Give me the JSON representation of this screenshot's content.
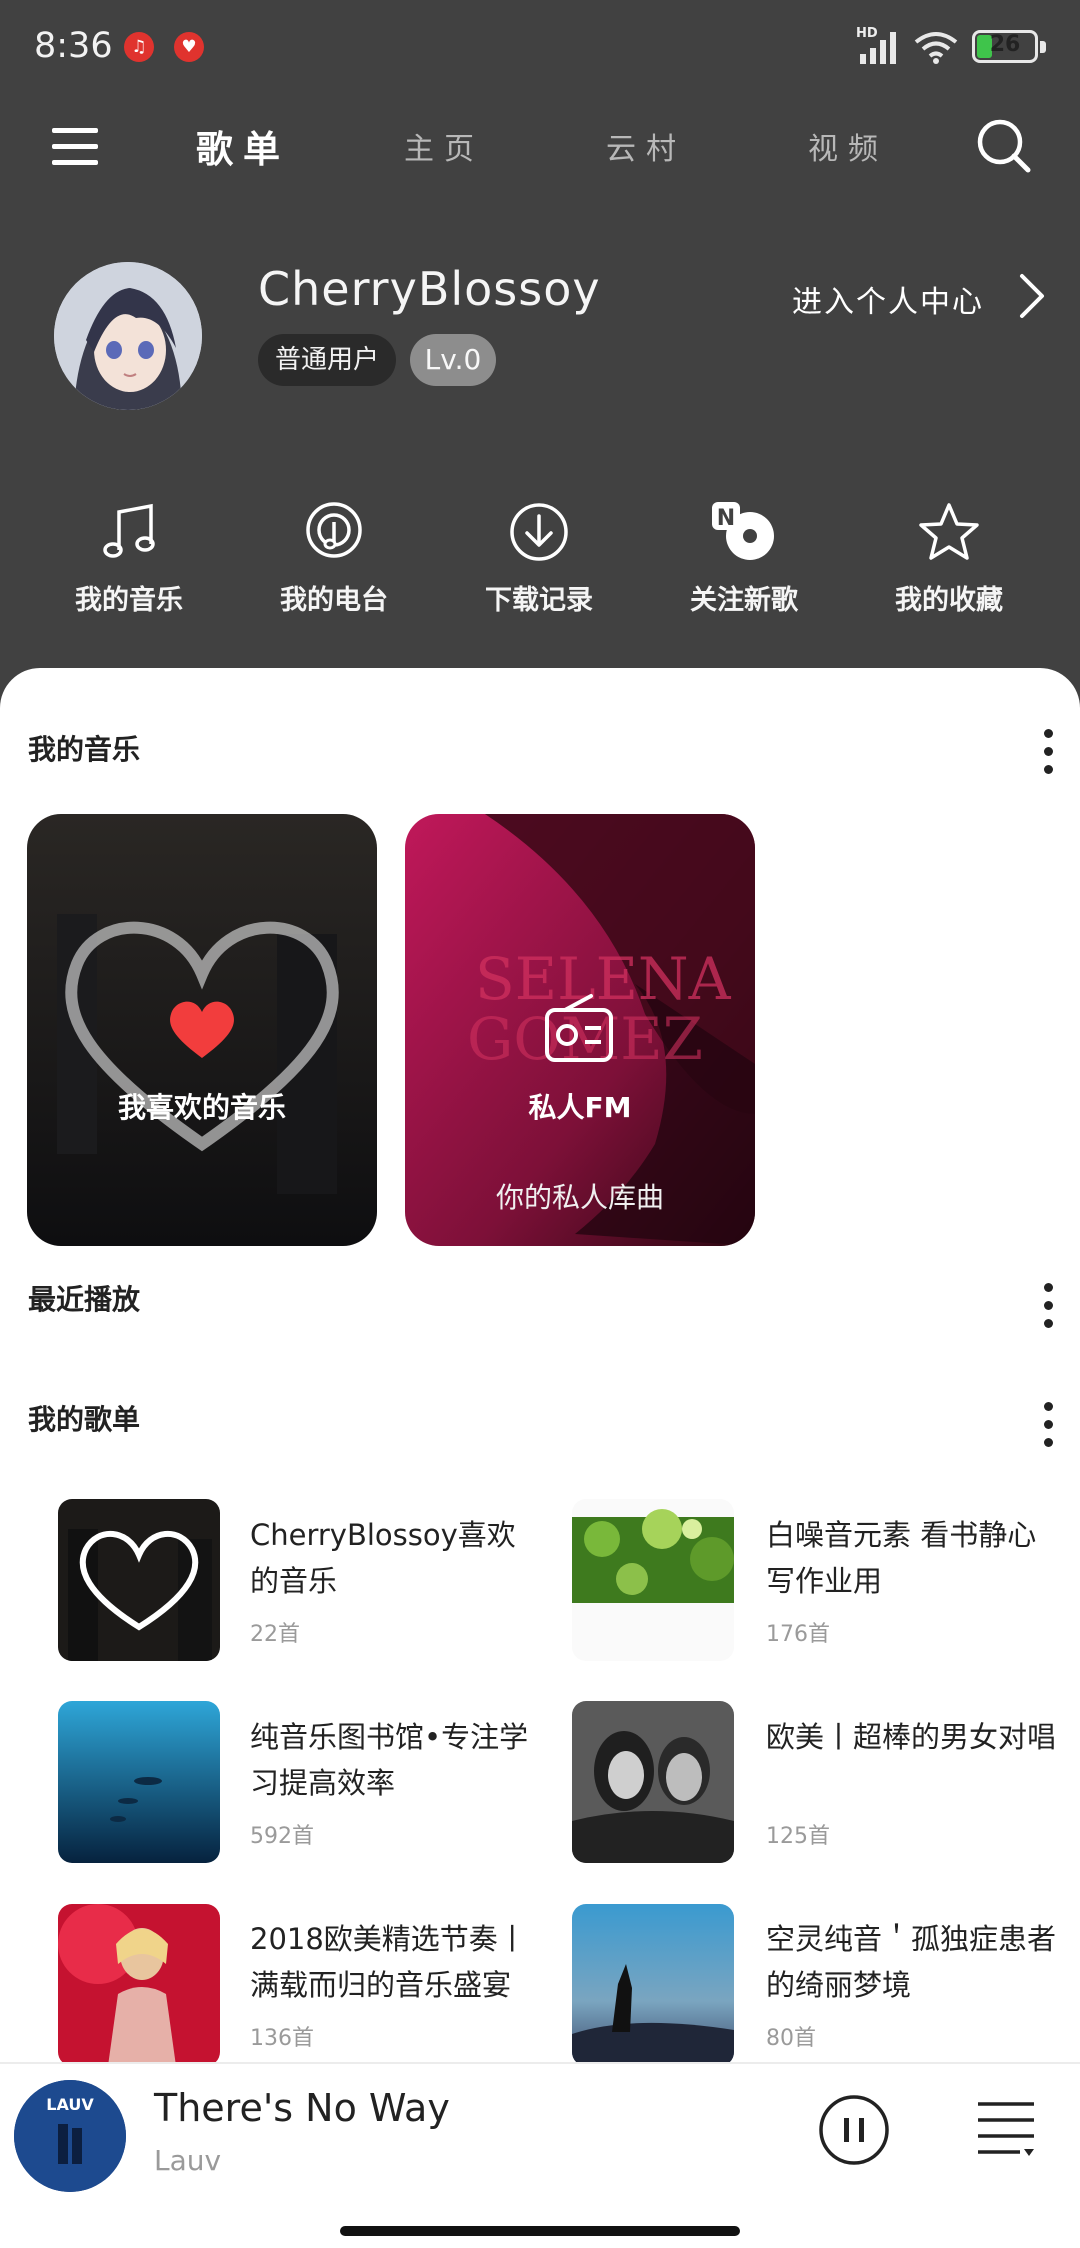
{
  "status_bar": {
    "time": "8:36",
    "network": "HD",
    "battery": "26",
    "battery_level": 0.26,
    "notification_icons": [
      "music-notification-icon",
      "app-notification-icon"
    ]
  },
  "nav": {
    "menu_icon": "hamburger-icon",
    "tabs": [
      {
        "label": "歌单",
        "active": true
      },
      {
        "label": "主页",
        "active": false
      },
      {
        "label": "云村",
        "active": false
      },
      {
        "label": "视频",
        "active": false
      }
    ],
    "search_icon": "search-icon"
  },
  "profile": {
    "username": "CherryBlossoy",
    "user_type": "普通用户",
    "level": "Lv.0",
    "center_link": "进入个人中心"
  },
  "quick_actions": [
    {
      "label": "我的音乐",
      "icon": "music-note-icon"
    },
    {
      "label": "我的电台",
      "icon": "podcast-icon"
    },
    {
      "label": "下载记录",
      "icon": "download-icon"
    },
    {
      "label": "关注新歌",
      "icon": "new-song-icon"
    },
    {
      "label": "我的收藏",
      "icon": "star-icon"
    }
  ],
  "my_music": {
    "title": "我的音乐",
    "cards": [
      {
        "title": "我喜欢的音乐",
        "subtitle": ""
      },
      {
        "title": "私人FM",
        "subtitle": "你的私人库曲"
      }
    ]
  },
  "recent": {
    "title": "最近播放"
  },
  "playlists": {
    "title": "我的歌单",
    "items": [
      {
        "title": "CherryBlossoy喜欢的音乐",
        "count": "22首"
      },
      {
        "title": "白噪音元素 看书静心写作业用",
        "count": "176首"
      },
      {
        "title": "纯音乐图书馆•专注学习提高效率",
        "count": "592首"
      },
      {
        "title": "欧美丨超棒的男女对唱",
        "count": "125首"
      },
      {
        "title": "2018欧美精选节奏丨满载而归的音乐盛宴",
        "count": "136首"
      },
      {
        "title": "空灵纯音＇孤独症患者的绮丽梦境",
        "count": "80首"
      }
    ]
  },
  "player": {
    "title": "There's No Way",
    "artist": "Lauv",
    "cover_text": "LAUV",
    "play_state": "playing"
  },
  "colors": {
    "header_bg": "#414141",
    "sheet_bg": "#ffffff",
    "heart_red": "#f23d3d",
    "fm_pink": "#b01a4f"
  }
}
